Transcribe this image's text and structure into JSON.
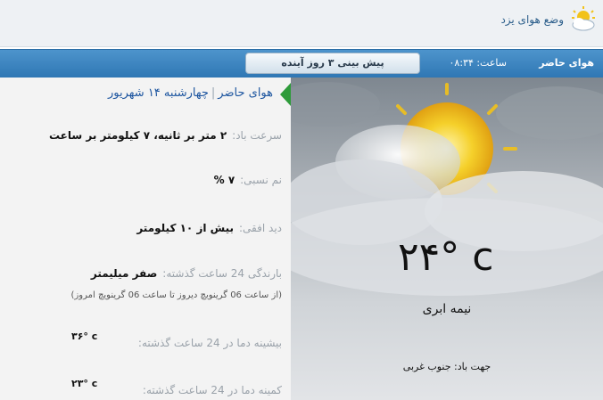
{
  "header": {
    "title": "وضع هوای یزد",
    "logo_icon": "sun-cloud-icon"
  },
  "tabbar": {
    "current_label": "هوای حاضر",
    "time_label": "ساعت: ۰۸:۳۴",
    "forecast_button": "پیش بینی ۳ روز آینده"
  },
  "details": {
    "title": "هوای حاضر",
    "date": "چهارشنبه ۱۴ شهریور",
    "wind_speed": {
      "label": "سرعت باد:",
      "value": "۲ متر بر ثانیه، ۷ کیلومتر بر ساعت"
    },
    "humidity": {
      "label": "نم نسبی:",
      "value": "۷ %"
    },
    "visibility": {
      "label": "دید افقی:",
      "value": "بیش از ۱۰ کیلومتر"
    },
    "precipitation": {
      "label": "بارندگی 24 ساعت گذشته:",
      "value": "صفر میلیمتر",
      "note": "(از ساعت 06 گرینویچ دیروز تا ساعت 06 گرینویچ امروز)"
    },
    "max_temp": {
      "label": "بیشینه دما در 24 ساعت گذشته:",
      "value": "۳۶° c"
    },
    "min_temp": {
      "label": "کمینه دما در 24 ساعت گذشته:",
      "value": "۲۳° c"
    }
  },
  "current": {
    "temperature": "۲۴° c",
    "condition": "نیمه ابری",
    "wind_direction": "جهت باد: جنوب غربی",
    "icon": "partly-cloudy-icon"
  },
  "colors": {
    "tab_blue": "#2f77b4",
    "title_blue": "#1e56a0",
    "arrow_green": "#2e9b3a",
    "sun_yellow": "#f2c21a"
  }
}
